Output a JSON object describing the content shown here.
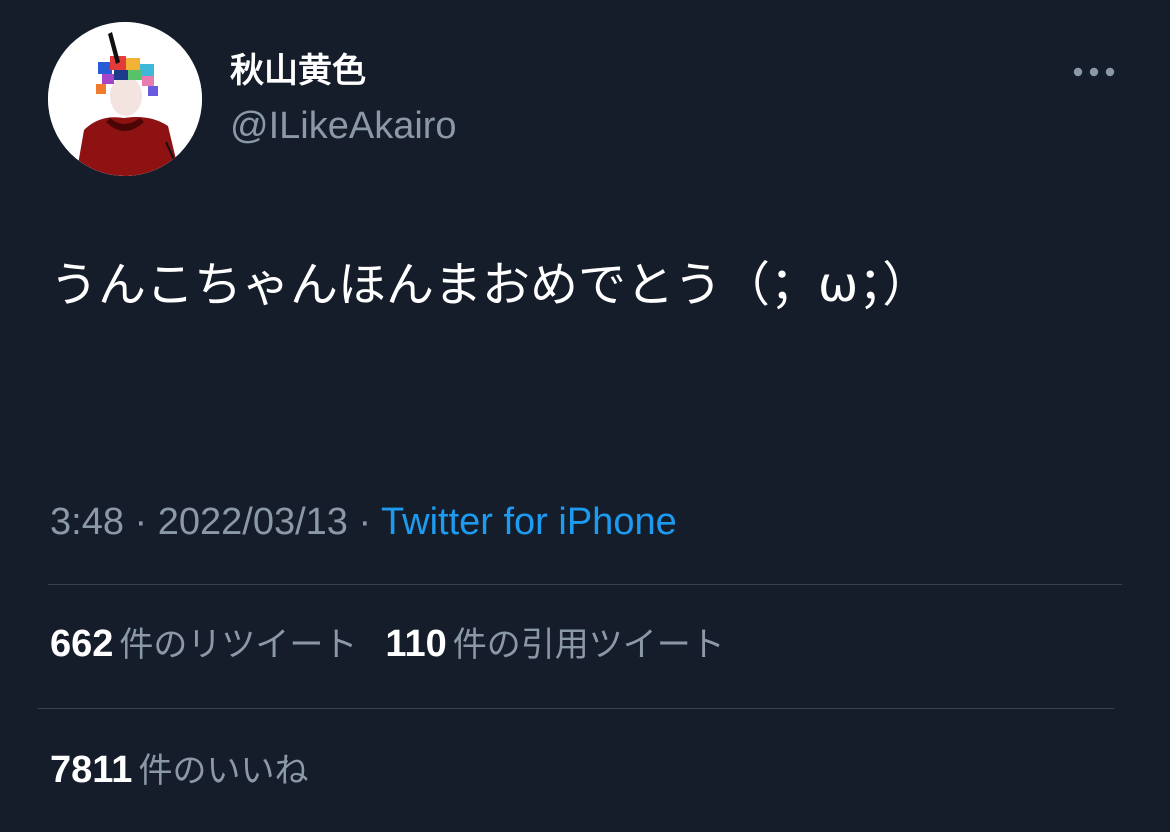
{
  "tweet": {
    "display_name": "秋山黄色",
    "handle": "@ILikeAkairo",
    "text": "うんこちゃんほんまおめでとう（；ω；）",
    "time": "3:48",
    "separator1": " · ",
    "date": "2022/03/13",
    "separator2": " · ",
    "source": "Twitter for iPhone",
    "avatar_icon": "profile-avatar",
    "more_icon": "more-options-icon"
  },
  "stats": {
    "retweets": {
      "count": "662",
      "label": "件のリツイート"
    },
    "quote_tweets": {
      "count": "110",
      "label": "件の引用ツイート"
    },
    "likes": {
      "count": "7811",
      "label": "件のいいね"
    }
  },
  "colors": {
    "background": "#151d2a",
    "primary_text": "#ffffff",
    "secondary_text": "#8b98a5",
    "link": "#1d9bf0",
    "divider": "#38444d"
  }
}
